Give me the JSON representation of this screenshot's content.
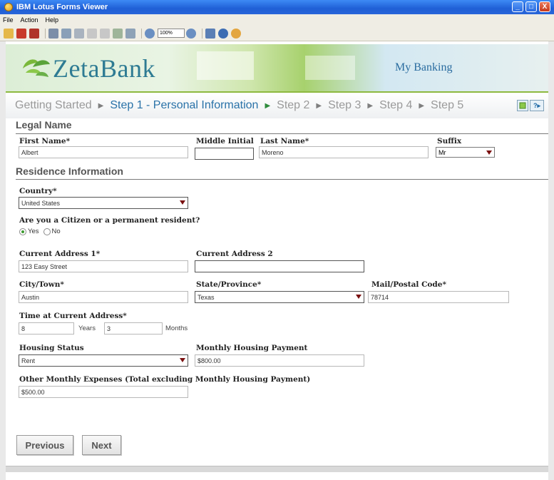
{
  "window": {
    "title": "IBM Lotus Forms Viewer",
    "minimize": "_",
    "maximize": "□",
    "close": "X"
  },
  "menu": [
    "File",
    "Action",
    "Help"
  ],
  "toolbar": {
    "zoom": "100%"
  },
  "banner": {
    "logo": "ZetaBank",
    "tagline": "My Banking"
  },
  "steps": {
    "items": [
      "Getting Started",
      "Step 1 - Personal Information",
      "Step 2",
      "Step 3",
      "Step 4",
      "Step 5"
    ],
    "current_index": 1,
    "arrow": "▶",
    "help": "?▸"
  },
  "legal": {
    "title": "Legal Name",
    "first_label": "First Name*",
    "first_value": "Albert",
    "middle_label": "Middle Initial",
    "middle_value": "",
    "last_label": "Last Name*",
    "last_value": "Moreno",
    "suffix_label": "Suffix",
    "suffix_value": "Mr"
  },
  "residence": {
    "title": "Residence Information",
    "country_label": "Country*",
    "country_value": "United States",
    "citizen_label": "Are you a Citizen or a permanent resident?",
    "yes_label": "Yes",
    "no_label": "No",
    "citizen_selected": "Yes",
    "address1_label": "Current Address 1*",
    "address1_value": "123 Easy Street",
    "address2_label": "Current Address 2",
    "address2_value": "",
    "city_label": "City/Town*",
    "city_value": "Austin",
    "state_label": "State/Province*",
    "state_value": "Texas",
    "zip_label": "Mail/Postal Code*",
    "zip_value": "78714",
    "time_label": "Time at Current Address*",
    "years_value": "8",
    "years_label": "Years",
    "months_value": "3",
    "months_label": "Months",
    "housing_label": "Housing Status",
    "housing_value": "Rent",
    "payment_label": "Monthly Housing Payment",
    "payment_value": "$800.00",
    "other_label": "Other Monthly Expenses (Total excluding Monthly Housing Payment)",
    "other_value": "$500.00"
  },
  "buttons": {
    "previous": "Previous",
    "next": "Next"
  }
}
